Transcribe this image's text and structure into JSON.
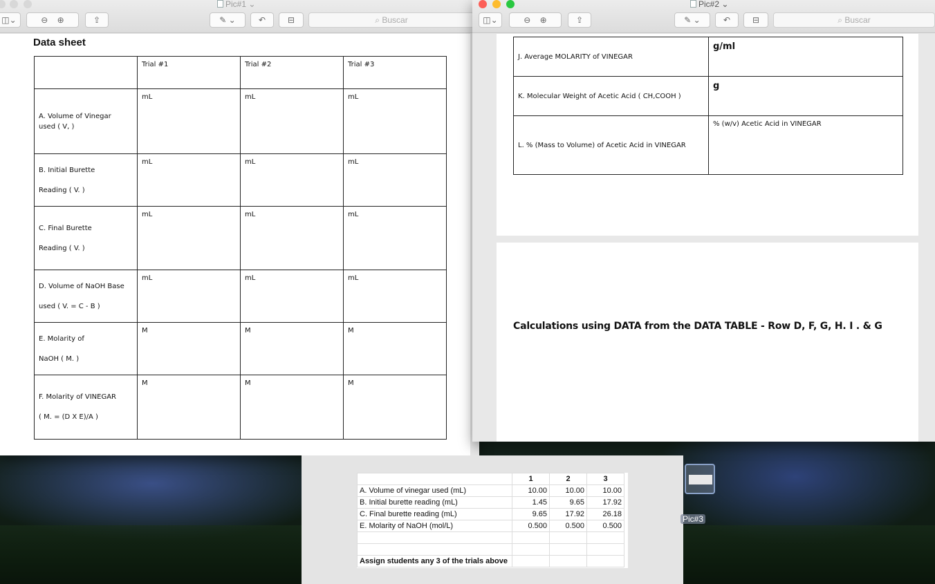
{
  "window1": {
    "title": "Pic#1",
    "search_placeholder": "Buscar",
    "sheet_title": "Data sheet",
    "columns": [
      "Trial  #1",
      "Trial  #2",
      "Trial  #3"
    ],
    "rows": [
      {
        "line1": "A. Volume of Vinegar",
        "line2": "used ( V, )",
        "unit": "mL"
      },
      {
        "line1": "B. Initial Burette",
        "line2": "Reading ( V. )",
        "unit": "mL"
      },
      {
        "line1": "C. Final Burette",
        "line2": "Reading ( V. )",
        "unit": "mL"
      },
      {
        "line1": "D. Volume of NaOH  Base",
        "line2": "used  ( V.  = C - B )",
        "unit": "mL"
      },
      {
        "line1": "E. Molarity  of",
        "line2": "NaOH ( M. )",
        "unit": "M"
      },
      {
        "line1": "F. Molarity  of VINEGAR",
        "line2": "( M. = (D  X  E)/A )",
        "unit": "M"
      }
    ]
  },
  "window2": {
    "title": "Pic#2",
    "search_placeholder": "Buscar",
    "rows": [
      {
        "label": "J.  Average MOLARITY  of VINEGAR",
        "value": "g/ml"
      },
      {
        "label": "K. Molecular Weight of Acetic Acid  (  CH,COOH  )",
        "value": "g"
      },
      {
        "label": "L. % (Mass to Volume) of Acetic Acid in VINEGAR",
        "value": "%  (w/v)  Acetic Acid  in VINEGAR"
      }
    ],
    "calculations_text": "Calculations using  DATA  from the  DATA TABLE  -  Row  D, F, G, H. I . & G"
  },
  "spreadsheet": {
    "header": [
      "",
      "1",
      "2",
      "3"
    ],
    "rows": [
      [
        "A. Volume of vinegar used (mL)",
        "10.00",
        "10.00",
        "10.00"
      ],
      [
        "B. Initial burette reading (mL)",
        "1.45",
        "9.65",
        "17.92"
      ],
      [
        "C. Final burette reading (mL)",
        "9.65",
        "17.92",
        "26.18"
      ],
      [
        "E. Molarity of NaOH (mol/L)",
        "0.500",
        "0.500",
        "0.500"
      ]
    ],
    "note": "Assign students any 3 of the trials above"
  },
  "desktop": {
    "file_label": "Pic#3"
  },
  "colors": {
    "close": "#fc5f57",
    "minimize": "#fdbc2e",
    "zoom": "#29c840"
  }
}
